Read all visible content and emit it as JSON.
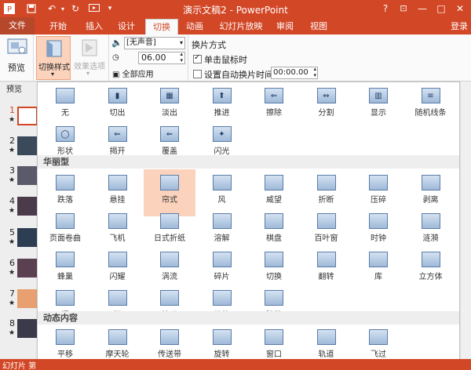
{
  "window": {
    "title": "演示文稿2 - PowerPoint",
    "help": "?",
    "restore_ribbon": "⊡",
    "minimize": "—",
    "maximize": "□",
    "close": "✕"
  },
  "tabs": [
    {
      "label": "文件"
    },
    {
      "label": "开始"
    },
    {
      "label": "插入"
    },
    {
      "label": "设计"
    },
    {
      "label": "切换"
    },
    {
      "label": "动画"
    },
    {
      "label": "幻灯片放映"
    },
    {
      "label": "审阅"
    },
    {
      "label": "视图"
    }
  ],
  "signin": "登录",
  "ribbon": {
    "preview_label": "预览",
    "preview_group": "预览",
    "transition_style": "切换样式",
    "effect_options": "效果选项",
    "sound_value": "[无声音]",
    "duration_value": "06.00",
    "apply_all": "全部应用",
    "advance_title": "换片方式",
    "on_click": "单击鼠标时",
    "auto_after": "设置自动换片时间:",
    "auto_time": "00:00.00"
  },
  "slides": [
    {
      "num": "1",
      "star": "★"
    },
    {
      "num": "2",
      "star": "★"
    },
    {
      "num": "3",
      "star": "★"
    },
    {
      "num": "4",
      "star": "★"
    },
    {
      "num": "5",
      "star": "★"
    },
    {
      "num": "6",
      "star": "★"
    },
    {
      "num": "7",
      "star": "★"
    },
    {
      "num": "8",
      "star": "★"
    }
  ],
  "status_text": "幻灯片 第",
  "gallery": {
    "subtle_items": [
      "无",
      "切出",
      "淡出",
      "推进",
      "擦除",
      "分割",
      "显示",
      "随机线条",
      "形状",
      "揭开",
      "覆盖",
      "闪光"
    ],
    "exciting_title": "华丽型",
    "exciting_items": [
      "跌落",
      "悬挂",
      "帘式",
      "风",
      "威望",
      "折断",
      "压碎",
      "剥离",
      "页面卷曲",
      "飞机",
      "日式折纸",
      "溶解",
      "棋盘",
      "百叶窗",
      "时钟",
      "涟漪",
      "蜂巢",
      "闪耀",
      "涡流",
      "碎片",
      "切换",
      "翻转",
      "库",
      "立方体",
      "门",
      "框",
      "梳理",
      "缩放",
      "随机"
    ],
    "dynamic_title": "动态内容",
    "dynamic_items": [
      "平移",
      "摩天轮",
      "传送带",
      "旋转",
      "窗口",
      "轨道",
      "飞过"
    ],
    "selected": "帘式"
  },
  "colors": {
    "accent": "#d24726",
    "selected": "#fbd3bc"
  }
}
